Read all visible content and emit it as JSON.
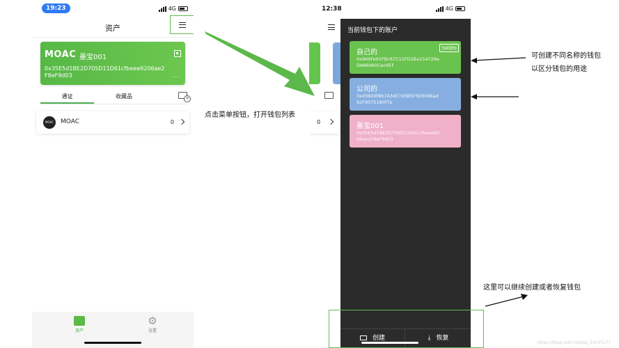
{
  "left_phone": {
    "status_time": "19:23",
    "network": "4G",
    "title": "资产",
    "wallet_card": {
      "logo": "MOAC",
      "name": "墨宝001",
      "address": "0x35E5d1BE2D705D11D61cfbeee9206ae2F8eF9d03",
      "more": "..."
    },
    "tabs": [
      "通证",
      "收藏品"
    ],
    "tokens": [
      {
        "logo": "MOAC",
        "name": "MOAC",
        "balance": "0"
      }
    ],
    "nav": {
      "assets": "资产",
      "settings": "设置"
    }
  },
  "annotations": {
    "menu_note": "点击菜单按钮，打开钱包列表",
    "accounts_note_line1": "可创建不同名称的钱包",
    "accounts_note_line2": "以区分钱包的用途",
    "create_note": "这里可以继续创建或者恢复钱包"
  },
  "right_phone": {
    "status_time": "12:38",
    "network": "4G",
    "peek_balance": "0",
    "drawer_title": "当前钱包下的账户",
    "accounts": [
      {
        "name": "自己的",
        "address": "0x969Fe91FBc67C12FD2Ba154728eDA86960Cec6EF",
        "badge": "当前钱包",
        "color": "#6ac24f"
      },
      {
        "name": "公司的",
        "address": "0xd3800f8b7A34E7d3B5F5E8098ad62F9075180f7e",
        "badge": "",
        "color": "#86aee0"
      },
      {
        "name": "墨宝001",
        "address": "0x35E5d1BE2D705D11D61cfbeee9206ae2F8eF9d03",
        "badge": "",
        "color": "#efb0c8"
      }
    ],
    "footer": {
      "create": "创建",
      "restore": "恢复"
    }
  },
  "watermark": "https://blog.csdn.net/qq_34245177",
  "colors": {
    "accent_green": "#5fbd4f",
    "drawer_bg": "#2b2b2b"
  }
}
